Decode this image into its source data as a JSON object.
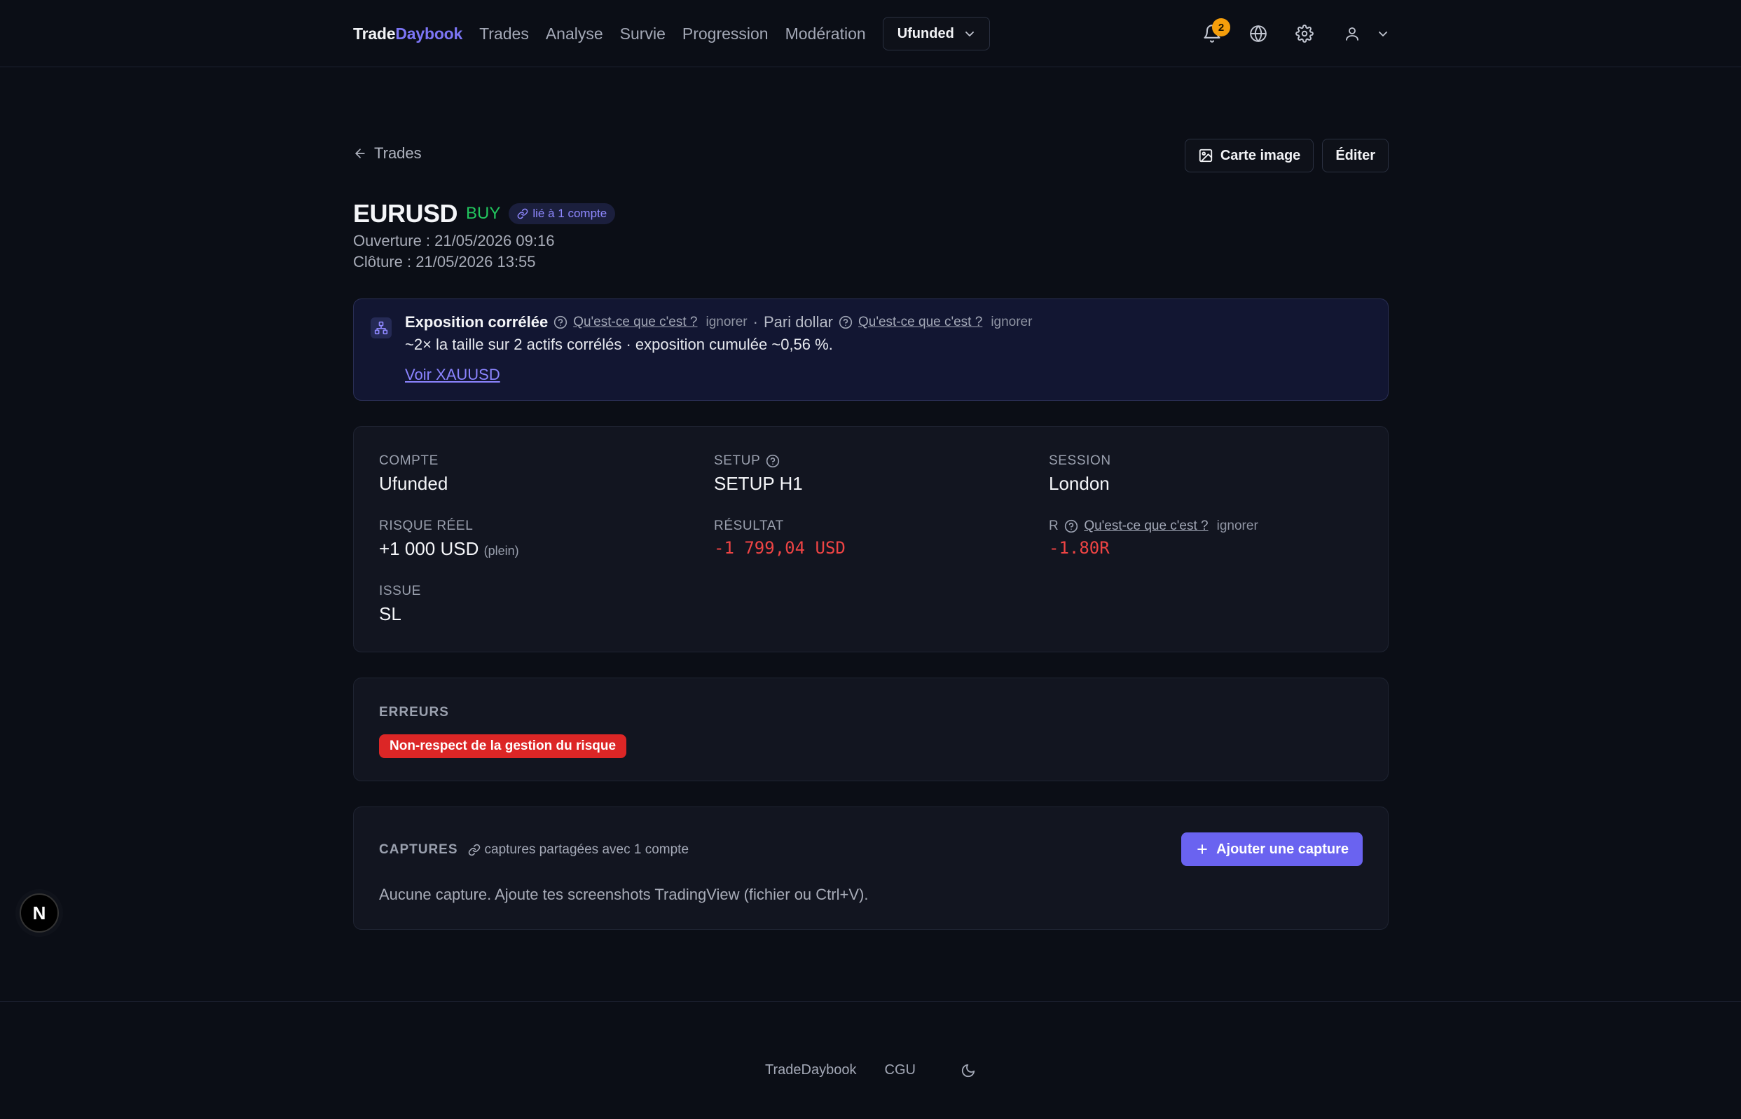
{
  "nav": {
    "brand_a": "Trade",
    "brand_b": "Daybook",
    "links": [
      "Trades",
      "Analyse",
      "Survie",
      "Progression",
      "Modération"
    ],
    "account": "Ufunded",
    "notifications_count": "2"
  },
  "page": {
    "back_label": "Trades",
    "btn_card": "Carte image",
    "btn_edit": "Éditer",
    "symbol": "EURUSD",
    "side": "BUY",
    "linked": "lié à 1 compte",
    "opened": "Ouverture : 21/05/2026 09:16",
    "closed": "Clôture : 21/05/2026 13:55"
  },
  "exposure": {
    "title": "Exposition corrélée",
    "help": "Qu'est-ce que c'est ?",
    "ignore": "ignorer",
    "dot": "·",
    "pari": "Pari dollar",
    "help2": "Qu'est-ce que c'est ?",
    "ignore2": "ignorer",
    "desc": "~2× la taille sur 2 actifs corrélés · exposition cumulée ~0,56 %.",
    "link": "Voir XAUUSD"
  },
  "fields": {
    "compte_label": "COMPTE",
    "compte": "Ufunded",
    "setup_label": "SETUP",
    "setup": "SETUP H1",
    "session_label": "SESSION",
    "session": "London",
    "risque_label": "RISQUE RÉEL",
    "risque": "+1 000 USD",
    "risque_note": "(plein)",
    "resultat_label": "RÉSULTAT",
    "resultat": "-1 799,04 USD",
    "r_label": "R",
    "r_help": "Qu'est-ce que c'est ?",
    "r_ignore": "ignorer",
    "r_value": "-1.80R",
    "issue_label": "ISSUE",
    "issue": "SL"
  },
  "errors": {
    "title": "ERREURS",
    "items": [
      "Non-respect de la gestion du risque"
    ]
  },
  "captures": {
    "title": "CAPTURES",
    "shared": "captures partagées avec 1 compte",
    "add_btn": "Ajouter une capture",
    "empty": "Aucune capture. Ajoute tes screenshots TradingView (fichier ou Ctrl+V)."
  },
  "footer": {
    "brand": "TradeDaybook",
    "cgu": "CGU"
  },
  "dev_badge": "N"
}
